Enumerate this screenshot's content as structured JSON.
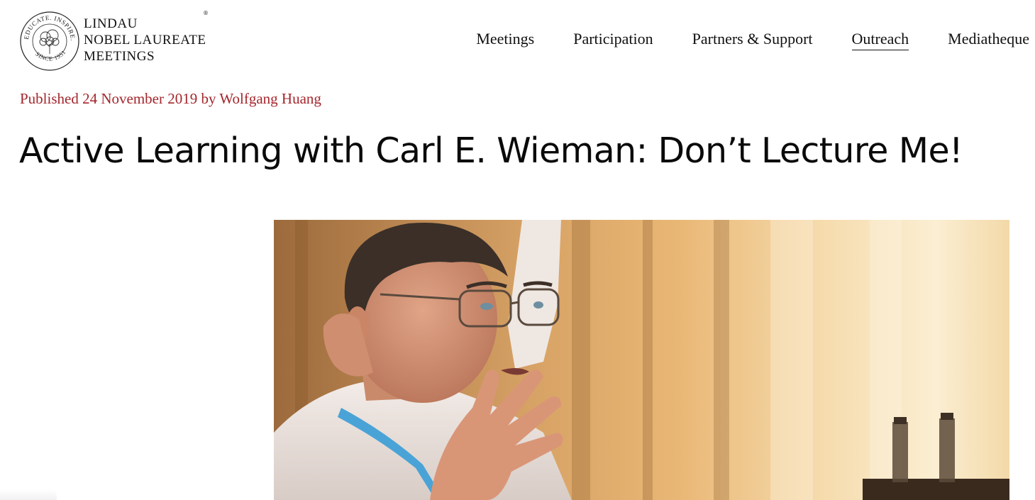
{
  "header": {
    "logo": {
      "seal_text_top": "EDUCATE. INSPIRE. CONNECT.",
      "seal_text_bottom": "SINCE 1951",
      "line1": "LINDAU",
      "line2": "NOBEL LAUREATE",
      "line3": "MEETINGS",
      "reg": "®"
    },
    "nav": [
      {
        "label": "Meetings",
        "active": false
      },
      {
        "label": "Participation",
        "active": false
      },
      {
        "label": "Partners & Support",
        "active": false
      },
      {
        "label": "Outreach",
        "active": true
      },
      {
        "label": "Mediatheque",
        "active": false
      }
    ]
  },
  "article": {
    "published_prefix": "Published 24 November 2019 by ",
    "author": "Wolfgang Huang",
    "title": "Active Learning with Carl E. Wieman: Don’t Lecture Me!",
    "meta_color": "#a4262c"
  }
}
